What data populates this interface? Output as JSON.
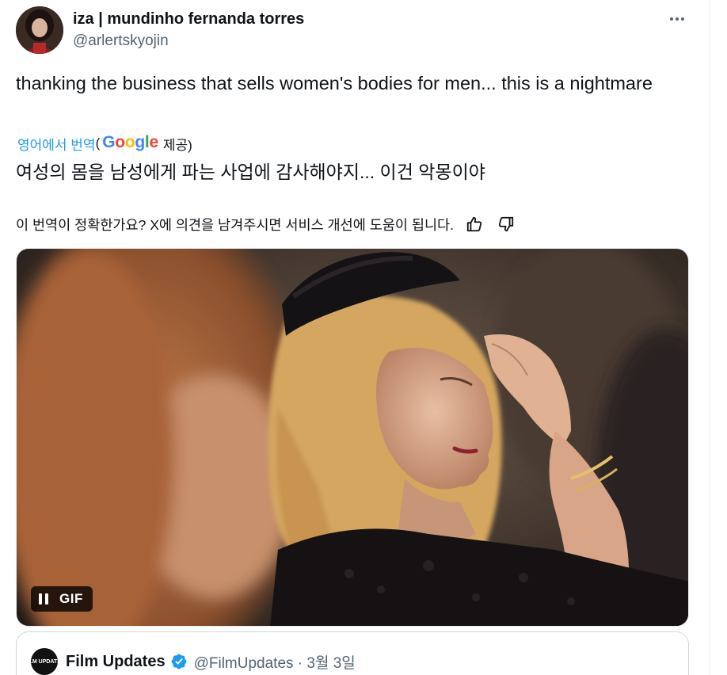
{
  "tweet": {
    "display_name": "iza | mundinho fernanda torres",
    "handle": "@arlertskyojin",
    "more_icon": "more-dots-icon",
    "text": "thanking the business that sells women's bodies for men... this is a nightmare"
  },
  "translation": {
    "link_label": "영어에서 번역",
    "paren_open": "(",
    "provider": "Google",
    "provider_suffix": "제공)",
    "translated_text": "여성의 몸을 남성에게 파는 사업에 감사해야지... 이건 악몽이야",
    "feedback_prompt": "이 번역이 정확한가요? X에 의견을 남겨주시면 서비스 개선에 도움이 됩니다.",
    "thumbs_up_icon": "thumbs-up-icon",
    "thumbs_down_icon": "thumbs-down-icon"
  },
  "media": {
    "badge_label": "GIF",
    "pause_icon": "pause-icon"
  },
  "quote": {
    "display_name": "Film Updates",
    "handle_date": "@FilmUpdates · 3월 3일",
    "avatar_text": "FILM UPDATES",
    "verified_icon": "verified-badge-icon",
    "verified_color": "#1d9bf0"
  },
  "colors": {
    "text": "#0f1419",
    "secondary": "#536471",
    "link": "#1d9bf0"
  }
}
